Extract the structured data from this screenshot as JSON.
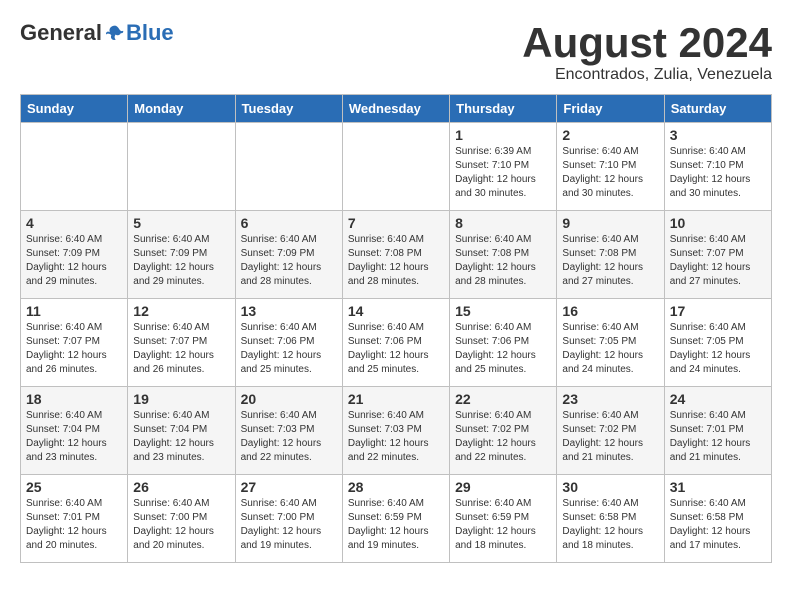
{
  "logo": {
    "general": "General",
    "blue": "Blue"
  },
  "title": {
    "month_year": "August 2024",
    "location": "Encontrados, Zulia, Venezuela"
  },
  "weekdays": [
    "Sunday",
    "Monday",
    "Tuesday",
    "Wednesday",
    "Thursday",
    "Friday",
    "Saturday"
  ],
  "weeks": [
    [
      {
        "day": "",
        "info": ""
      },
      {
        "day": "",
        "info": ""
      },
      {
        "day": "",
        "info": ""
      },
      {
        "day": "",
        "info": ""
      },
      {
        "day": "1",
        "info": "Sunrise: 6:39 AM\nSunset: 7:10 PM\nDaylight: 12 hours\nand 30 minutes."
      },
      {
        "day": "2",
        "info": "Sunrise: 6:40 AM\nSunset: 7:10 PM\nDaylight: 12 hours\nand 30 minutes."
      },
      {
        "day": "3",
        "info": "Sunrise: 6:40 AM\nSunset: 7:10 PM\nDaylight: 12 hours\nand 30 minutes."
      }
    ],
    [
      {
        "day": "4",
        "info": "Sunrise: 6:40 AM\nSunset: 7:09 PM\nDaylight: 12 hours\nand 29 minutes."
      },
      {
        "day": "5",
        "info": "Sunrise: 6:40 AM\nSunset: 7:09 PM\nDaylight: 12 hours\nand 29 minutes."
      },
      {
        "day": "6",
        "info": "Sunrise: 6:40 AM\nSunset: 7:09 PM\nDaylight: 12 hours\nand 28 minutes."
      },
      {
        "day": "7",
        "info": "Sunrise: 6:40 AM\nSunset: 7:08 PM\nDaylight: 12 hours\nand 28 minutes."
      },
      {
        "day": "8",
        "info": "Sunrise: 6:40 AM\nSunset: 7:08 PM\nDaylight: 12 hours\nand 28 minutes."
      },
      {
        "day": "9",
        "info": "Sunrise: 6:40 AM\nSunset: 7:08 PM\nDaylight: 12 hours\nand 27 minutes."
      },
      {
        "day": "10",
        "info": "Sunrise: 6:40 AM\nSunset: 7:07 PM\nDaylight: 12 hours\nand 27 minutes."
      }
    ],
    [
      {
        "day": "11",
        "info": "Sunrise: 6:40 AM\nSunset: 7:07 PM\nDaylight: 12 hours\nand 26 minutes."
      },
      {
        "day": "12",
        "info": "Sunrise: 6:40 AM\nSunset: 7:07 PM\nDaylight: 12 hours\nand 26 minutes."
      },
      {
        "day": "13",
        "info": "Sunrise: 6:40 AM\nSunset: 7:06 PM\nDaylight: 12 hours\nand 25 minutes."
      },
      {
        "day": "14",
        "info": "Sunrise: 6:40 AM\nSunset: 7:06 PM\nDaylight: 12 hours\nand 25 minutes."
      },
      {
        "day": "15",
        "info": "Sunrise: 6:40 AM\nSunset: 7:06 PM\nDaylight: 12 hours\nand 25 minutes."
      },
      {
        "day": "16",
        "info": "Sunrise: 6:40 AM\nSunset: 7:05 PM\nDaylight: 12 hours\nand 24 minutes."
      },
      {
        "day": "17",
        "info": "Sunrise: 6:40 AM\nSunset: 7:05 PM\nDaylight: 12 hours\nand 24 minutes."
      }
    ],
    [
      {
        "day": "18",
        "info": "Sunrise: 6:40 AM\nSunset: 7:04 PM\nDaylight: 12 hours\nand 23 minutes."
      },
      {
        "day": "19",
        "info": "Sunrise: 6:40 AM\nSunset: 7:04 PM\nDaylight: 12 hours\nand 23 minutes."
      },
      {
        "day": "20",
        "info": "Sunrise: 6:40 AM\nSunset: 7:03 PM\nDaylight: 12 hours\nand 22 minutes."
      },
      {
        "day": "21",
        "info": "Sunrise: 6:40 AM\nSunset: 7:03 PM\nDaylight: 12 hours\nand 22 minutes."
      },
      {
        "day": "22",
        "info": "Sunrise: 6:40 AM\nSunset: 7:02 PM\nDaylight: 12 hours\nand 22 minutes."
      },
      {
        "day": "23",
        "info": "Sunrise: 6:40 AM\nSunset: 7:02 PM\nDaylight: 12 hours\nand 21 minutes."
      },
      {
        "day": "24",
        "info": "Sunrise: 6:40 AM\nSunset: 7:01 PM\nDaylight: 12 hours\nand 21 minutes."
      }
    ],
    [
      {
        "day": "25",
        "info": "Sunrise: 6:40 AM\nSunset: 7:01 PM\nDaylight: 12 hours\nand 20 minutes."
      },
      {
        "day": "26",
        "info": "Sunrise: 6:40 AM\nSunset: 7:00 PM\nDaylight: 12 hours\nand 20 minutes."
      },
      {
        "day": "27",
        "info": "Sunrise: 6:40 AM\nSunset: 7:00 PM\nDaylight: 12 hours\nand 19 minutes."
      },
      {
        "day": "28",
        "info": "Sunrise: 6:40 AM\nSunset: 6:59 PM\nDaylight: 12 hours\nand 19 minutes."
      },
      {
        "day": "29",
        "info": "Sunrise: 6:40 AM\nSunset: 6:59 PM\nDaylight: 12 hours\nand 18 minutes."
      },
      {
        "day": "30",
        "info": "Sunrise: 6:40 AM\nSunset: 6:58 PM\nDaylight: 12 hours\nand 18 minutes."
      },
      {
        "day": "31",
        "info": "Sunrise: 6:40 AM\nSunset: 6:58 PM\nDaylight: 12 hours\nand 17 minutes."
      }
    ]
  ]
}
